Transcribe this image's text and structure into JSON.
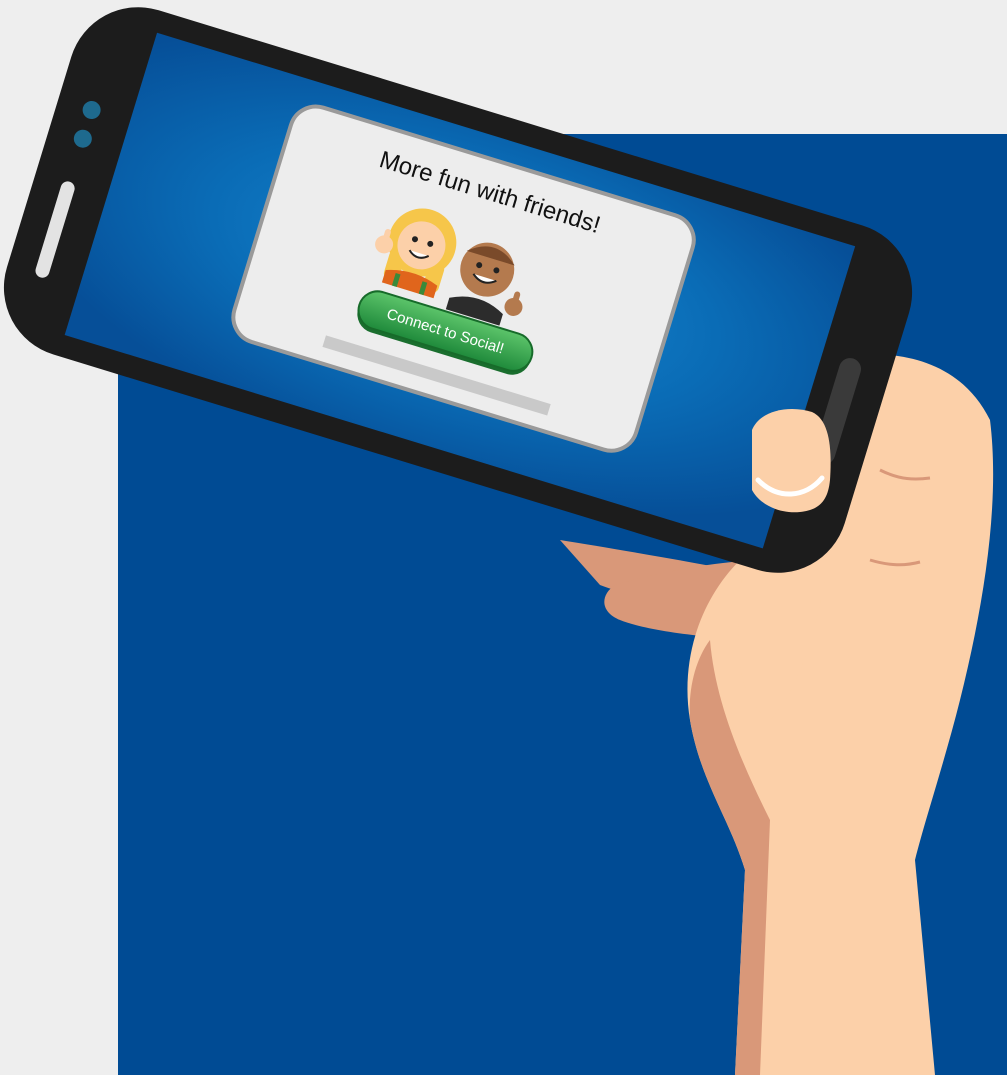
{
  "dialog": {
    "title": "More fun with friends!",
    "button_label": "Connect to Social!"
  },
  "colors": {
    "background": "#eeeeee",
    "panel_blue": "#004b94",
    "screen_blue": "#0a6fb8",
    "phone_body": "#1c1c1c",
    "button_green": "#2e9e4a",
    "skin": "#fcd0a9"
  },
  "icons": [
    "girl-thumbs-up-avatar",
    "boy-thumbs-up-avatar",
    "phone-camera-icon",
    "phone-speaker-icon"
  ]
}
